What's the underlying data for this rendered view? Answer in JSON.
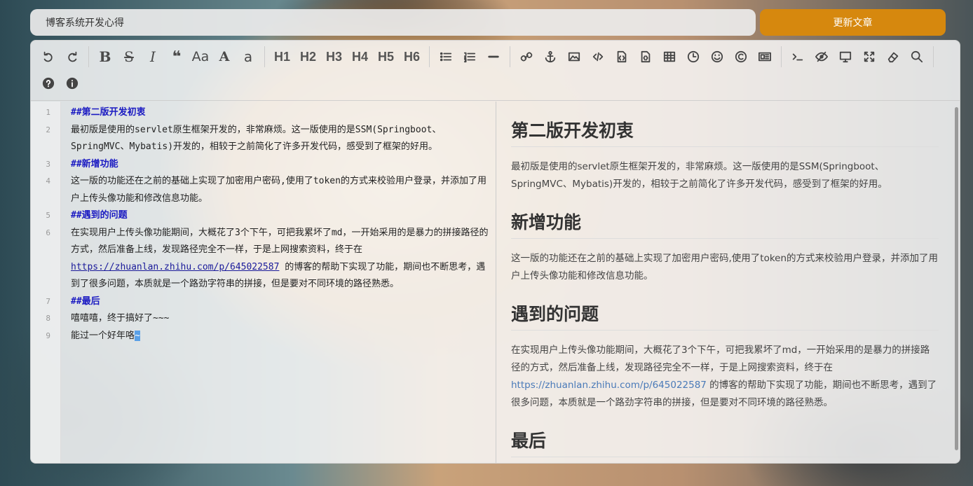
{
  "header": {
    "title_value": "博客系统开发心得",
    "update_button": "更新文章"
  },
  "toolbar": {
    "h1": "H1",
    "h2": "H2",
    "h3": "H3",
    "h4": "H4",
    "h5": "H5",
    "h6": "H6",
    "bold": "B",
    "strike": "S",
    "italic": "I",
    "quote": "❝",
    "upper": "Aa",
    "cap": "A",
    "lower": "a",
    "icons": [
      "undo-icon",
      "redo-icon",
      "bold-icon",
      "strikethrough-icon",
      "italic-icon",
      "quote-icon",
      "uppercase-icon",
      "capitalize-icon",
      "lowercase-icon",
      "h1-icon",
      "h2-icon",
      "h3-icon",
      "h4-icon",
      "h5-icon",
      "h6-icon",
      "unordered-list-icon",
      "ordered-list-icon",
      "horizontal-rule-icon",
      "link-icon",
      "anchor-icon",
      "image-icon",
      "code-icon",
      "preformatted-code-icon",
      "code-block-icon",
      "table-icon",
      "datetime-icon",
      "emoji-icon",
      "html-entities-icon",
      "pagebreak-icon",
      "goto-line-icon",
      "watch-icon",
      "preview-icon",
      "fullscreen-icon",
      "clear-icon",
      "search-icon",
      "help-icon",
      "info-icon"
    ]
  },
  "editor": {
    "lines": [
      {
        "n": "1",
        "text": "##第二版开发初衷",
        "heading": true
      },
      {
        "n": "2",
        "text": "最初版是使用的servlet原生框架开发的，非常麻烦。这一版使用的是SSM(Springboot、SpringMVC、Mybatis)开发的，相较于之前简化了许多开发代码，感受到了框架的好用。"
      },
      {
        "n": "3",
        "text": "##新增功能",
        "heading": true
      },
      {
        "n": "4",
        "text": "这一版的功能还在之前的基础上实现了加密用户密码,使用了token的方式来校验用户登录，并添加了用户上传头像功能和修改信息功能。"
      },
      {
        "n": "5",
        "text": "##遇到的问题",
        "heading": true
      },
      {
        "n": "6",
        "text_before": "在实现用户上传头像功能期间，大概花了3个下午，可把我累坏了md，一开始采用的是暴力的拼接路径的方式，然后准备上线，发现路径完全不一样，于是上网搜索资料，终于在",
        "link": "https://zhuanlan.zhihu.com/p/645022587",
        "text_after": " 的博客的帮助下实现了功能，期间也不断思考，遇到了很多问题，本质就是一个路劲字符串的拼接，但是要对不同环境的路径熟悉。"
      },
      {
        "n": "7",
        "text": "##最后",
        "heading": true
      },
      {
        "n": "8",
        "text": "嘻嘻嘻，终于搞好了~~~"
      },
      {
        "n": "9",
        "text": "能过一个好年咯",
        "cursor_char": "~"
      }
    ]
  },
  "preview": {
    "h_1": "第二版开发初衷",
    "p_1": "最初版是使用的servlet原生框架开发的，非常麻烦。这一版使用的是SSM(Springboot、SpringMVC、Mybatis)开发的，相较于之前简化了许多开发代码，感受到了框架的好用。",
    "h_2": "新增功能",
    "p_2": "这一版的功能还在之前的基础上实现了加密用户密码,使用了token的方式来校验用户登录，并添加了用户上传头像功能和修改信息功能。",
    "h_3": "遇到的问题",
    "p_3_before": "在实现用户上传头像功能期间，大概花了3个下午，可把我累坏了md，一开始采用的是暴力的拼接路径的方式，然后准备上线，发现路径完全不一样，于是上网搜索资料，终于在",
    "p_3_link": "https://zhuanlan.zhihu.com/p/645022587",
    "p_3_after": " 的博客的帮助下实现了功能，期间也不断思考，遇到了很多问题，本质就是一个路劲字符串的拼接，但是要对不同环境的路径熟悉。",
    "h_4": "最后"
  }
}
